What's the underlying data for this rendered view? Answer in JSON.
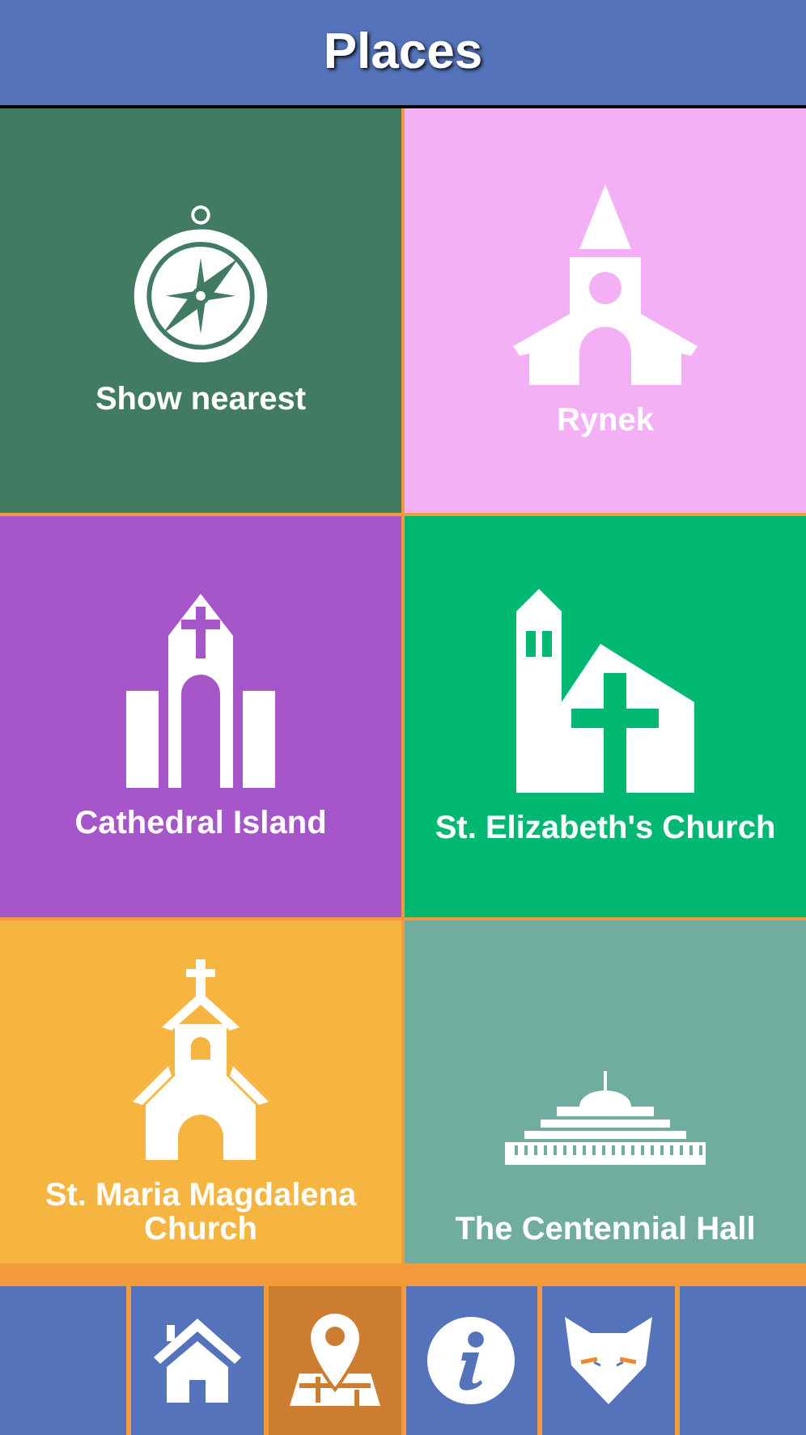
{
  "header": {
    "title": "Places"
  },
  "tiles": [
    {
      "label": "Show nearest",
      "kind": "compass",
      "color": "#417b62"
    },
    {
      "label": "Rynek",
      "kind": "chapel",
      "color": "#f4b0f5"
    },
    {
      "label": "Cathedral Island",
      "kind": "cathedral",
      "color": "#a656c8"
    },
    {
      "label": "St. Elizabeth's Church",
      "kind": "church",
      "color": "#00b872"
    },
    {
      "label": "St. Maria Magdalena Church",
      "kind": "steeple",
      "color": "#f5b540"
    },
    {
      "label": "The Centennial Hall",
      "kind": "hall",
      "color": "#71ad9e"
    }
  ],
  "nav": [
    {
      "kind": "home",
      "selected": false
    },
    {
      "kind": "map",
      "selected": true
    },
    {
      "kind": "info",
      "selected": false
    },
    {
      "kind": "fox",
      "selected": false
    }
  ]
}
